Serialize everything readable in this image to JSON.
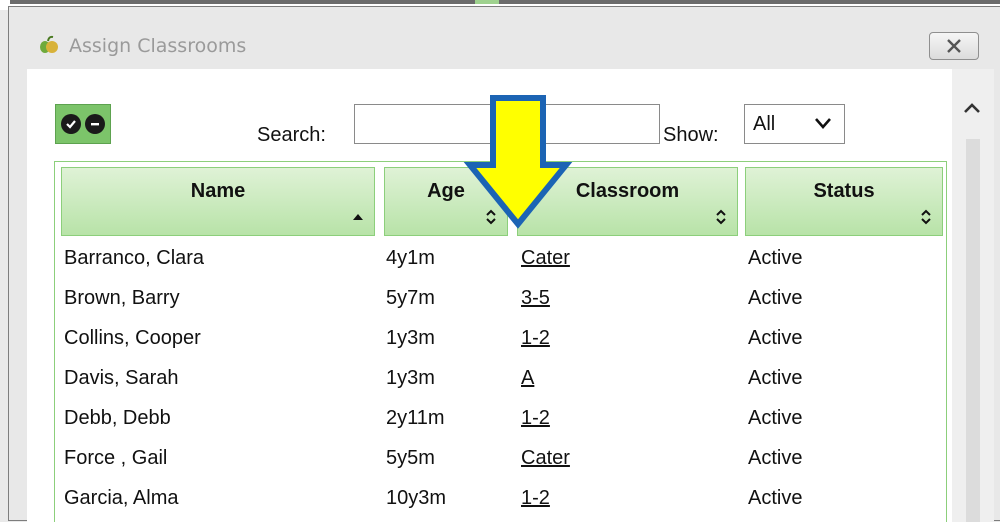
{
  "window": {
    "title": "Assign Classrooms",
    "close_glyph": "✕"
  },
  "toolbar": {
    "search_label": "Search:",
    "search_value": "",
    "show_label": "Show:",
    "show_value": "All"
  },
  "table": {
    "columns": [
      {
        "label": "Name",
        "sort": "ascending"
      },
      {
        "label": "Age",
        "sort": "both"
      },
      {
        "label": "Classroom",
        "sort": "both"
      },
      {
        "label": "Status",
        "sort": "both"
      }
    ],
    "rows": [
      {
        "name": "Barranco, Clara",
        "age": "4y1m",
        "classroom": "Cater",
        "status": "Active"
      },
      {
        "name": "Brown, Barry",
        "age": "5y7m",
        "classroom": "3-5",
        "status": "Active"
      },
      {
        "name": "Collins, Cooper",
        "age": "1y3m",
        "classroom": "1-2",
        "status": "Active"
      },
      {
        "name": "Davis, Sarah",
        "age": "1y3m",
        "classroom": "A",
        "status": "Active"
      },
      {
        "name": "Debb, Debb",
        "age": "2y11m",
        "classroom": "1-2",
        "status": "Active"
      },
      {
        "name": "Force , Gail",
        "age": "5y5m",
        "classroom": "Cater",
        "status": "Active"
      },
      {
        "name": "Garcia, Alma",
        "age": "10y3m",
        "classroom": "1-2",
        "status": "Active"
      }
    ]
  },
  "colors": {
    "header_green": "#b8e3a8",
    "grid_border": "#8ccf7b",
    "arrow_yellow": "#ffff00",
    "arrow_outline": "#1c64b4"
  },
  "icons": [
    "app-apple-icon",
    "close-icon",
    "expand-all-icon",
    "collapse-all-icon",
    "chevron-down-icon",
    "scroll-up-icon",
    "sort-icon",
    "callout-arrow-icon"
  ]
}
